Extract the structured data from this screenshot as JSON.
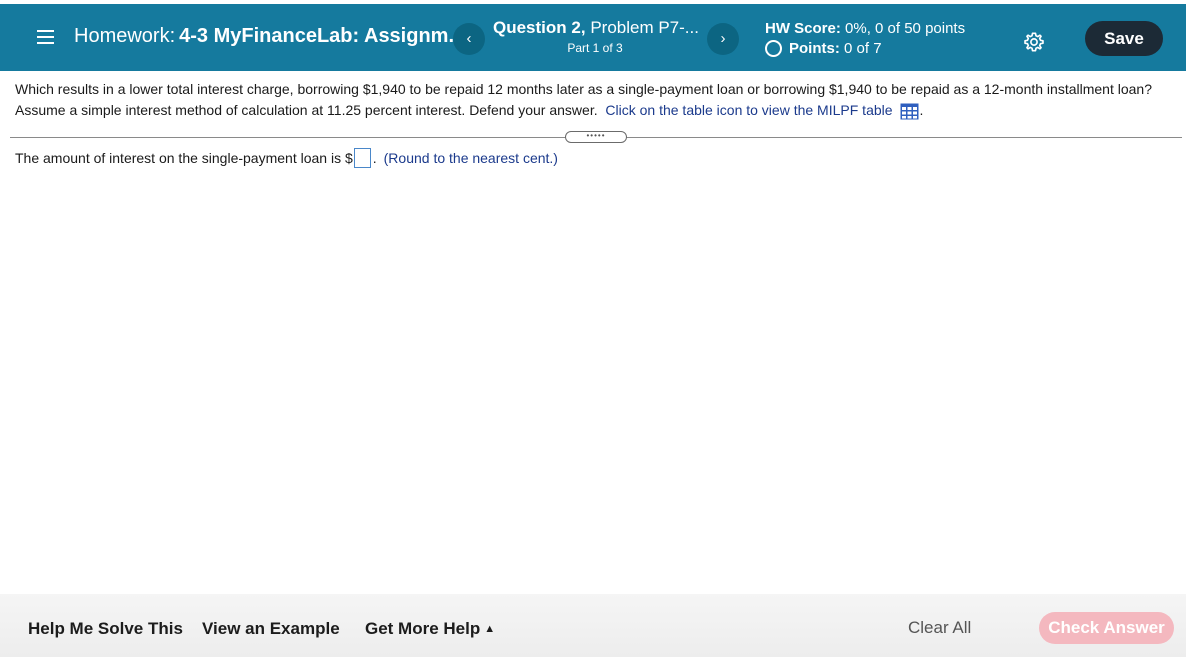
{
  "header": {
    "title_prefix": "Homework:",
    "title_name": "4-3 MyFinanceLab: Assignm...",
    "prev_icon": "‹",
    "next_icon": "›",
    "question_label": "Question 2,",
    "question_problem": "Problem P7-...",
    "part": "Part 1 of 3",
    "hw_score_label": "HW Score:",
    "hw_score_value": "0%, 0 of 50 points",
    "points_label": "Points:",
    "points_value": "0 of 7",
    "save_label": "Save",
    "accent_color": "#157a9e"
  },
  "question": {
    "text": "Which results in a lower total interest charge, borrowing $1,940 to be repaid 12 months later as a single-payment loan or borrowing $1,940 to be repaid as a 12-month installment loan? Assume a simple interest method of calculation at 11.25 percent interest. Defend your answer.",
    "link_text": "Click on the table icon to view the MILPF table",
    "period": "."
  },
  "answer": {
    "prompt": "The amount of interest on the single-payment loan is $",
    "input_value": "",
    "after_input": ".",
    "note": "(Round to the nearest cent.)"
  },
  "footer": {
    "help_solve": "Help Me Solve This",
    "view_example": "View an Example",
    "more_help": "Get More Help",
    "more_help_caret": "▲",
    "clear_all": "Clear All",
    "check_answer": "Check Answer"
  },
  "icons": [
    "menu-icon",
    "chevron-left-icon",
    "chevron-right-icon",
    "circle-icon",
    "gear-icon",
    "table-icon",
    "caret-up-icon"
  ]
}
